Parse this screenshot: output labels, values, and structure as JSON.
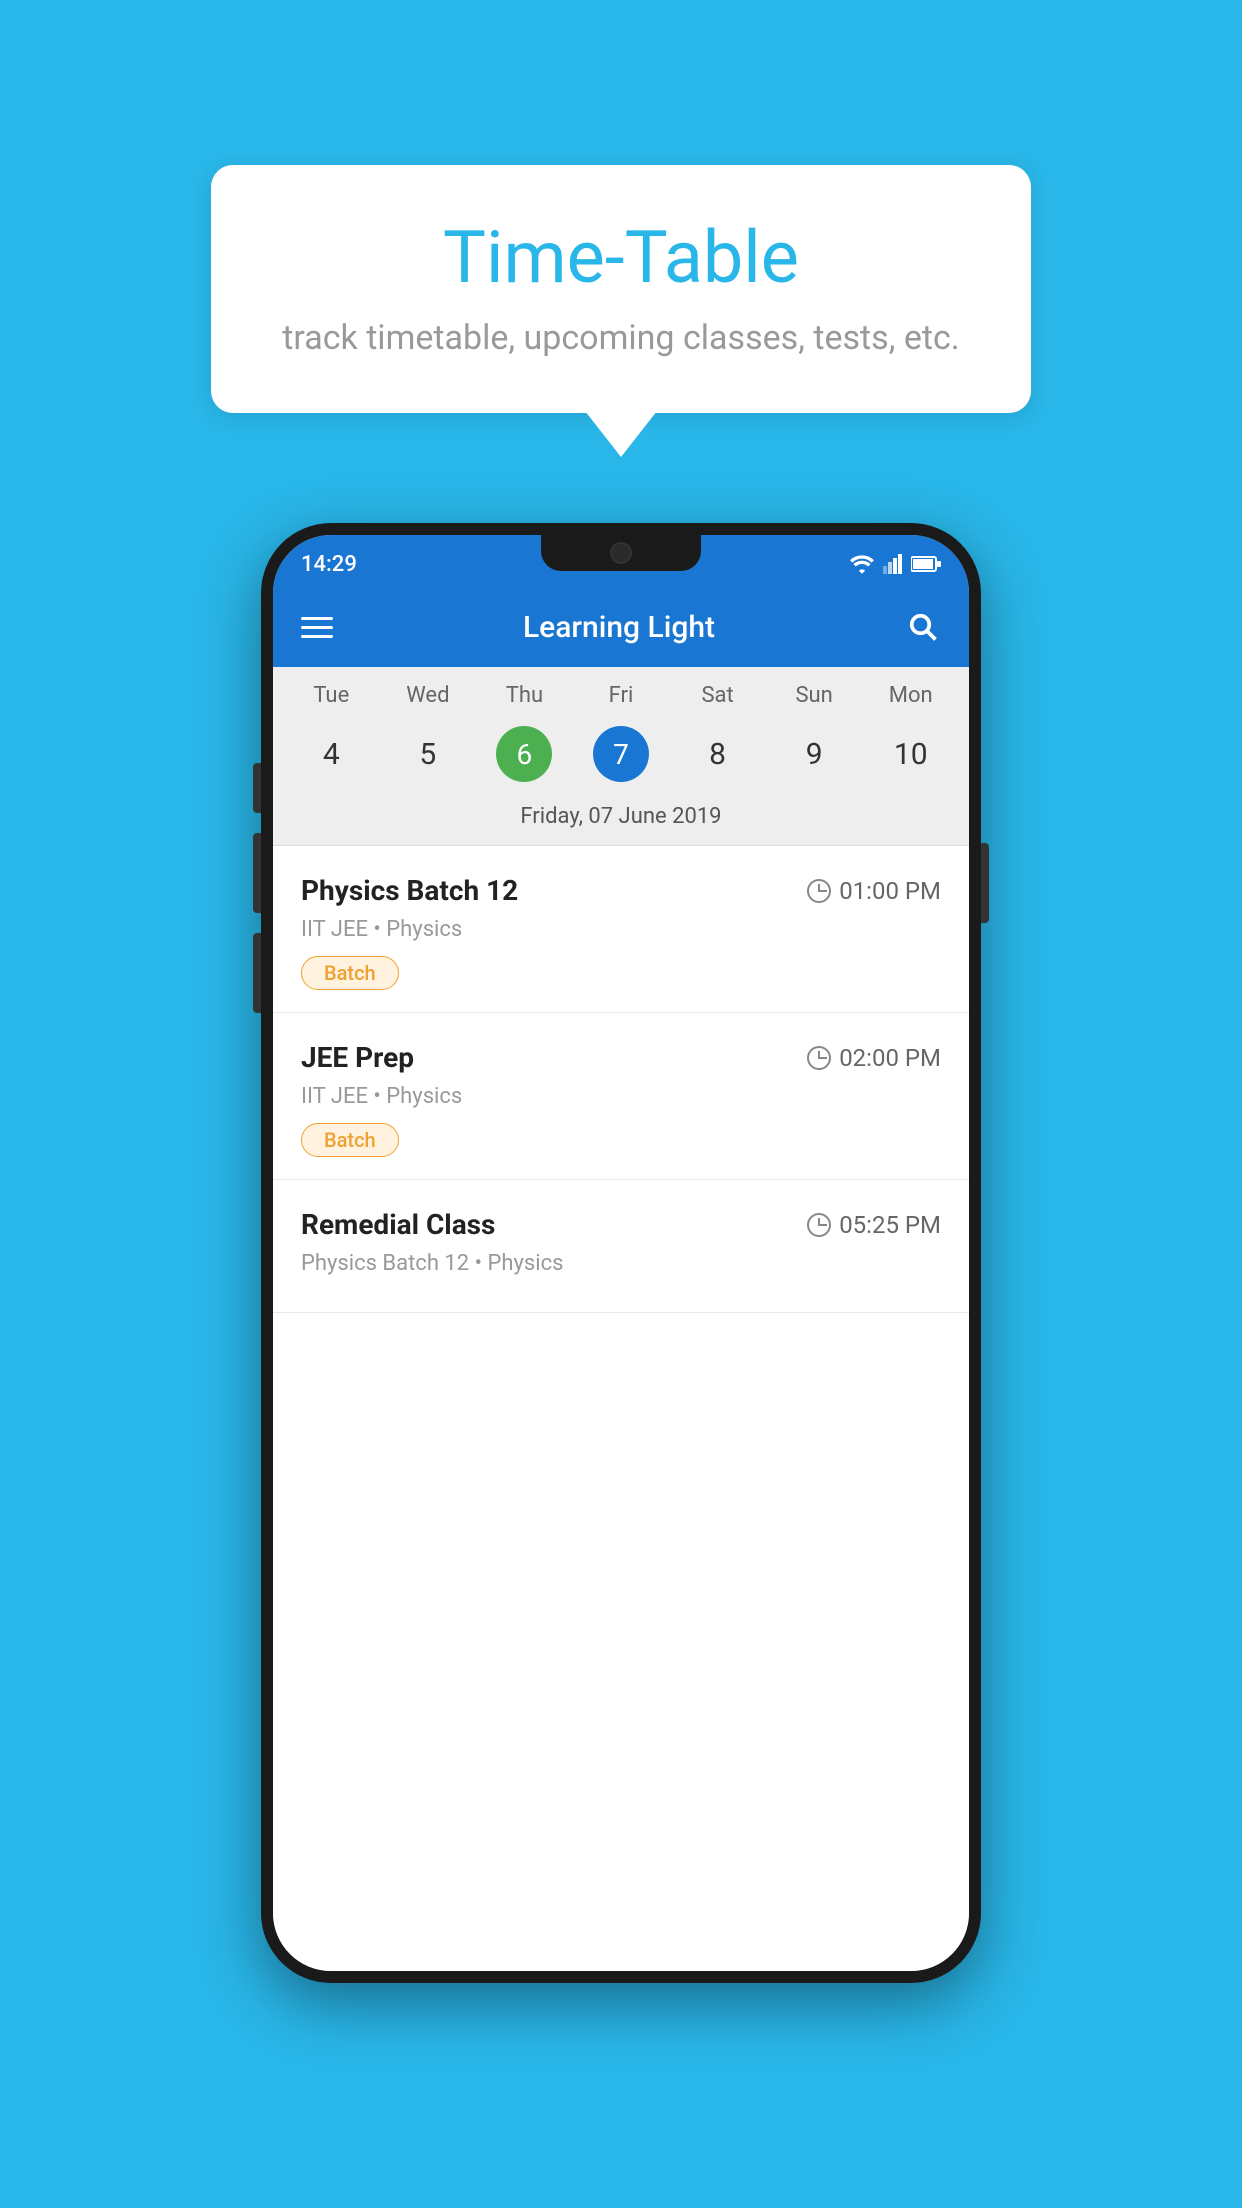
{
  "background_color": "#29b6e8",
  "bubble": {
    "title": "Time-Table",
    "subtitle": "track timetable, upcoming classes, tests, etc."
  },
  "status_bar": {
    "time": "14:29"
  },
  "app_bar": {
    "title": "Learning Light"
  },
  "calendar": {
    "days": [
      "Tue",
      "Wed",
      "Thu",
      "Fri",
      "Sat",
      "Sun",
      "Mon"
    ],
    "dates": [
      "4",
      "5",
      "6",
      "7",
      "8",
      "9",
      "10"
    ],
    "today_index": 2,
    "selected_index": 3,
    "selected_date_label": "Friday, 07 June 2019"
  },
  "schedule": [
    {
      "title": "Physics Batch 12",
      "time": "01:00 PM",
      "subtitle": "IIT JEE • Physics",
      "tag": "Batch"
    },
    {
      "title": "JEE Prep",
      "time": "02:00 PM",
      "subtitle": "IIT JEE • Physics",
      "tag": "Batch"
    },
    {
      "title": "Remedial Class",
      "time": "05:25 PM",
      "subtitle": "Physics Batch 12 • Physics",
      "tag": ""
    }
  ],
  "icons": {
    "hamburger": "menu-icon",
    "search": "search-icon",
    "clock": "clock-icon"
  }
}
